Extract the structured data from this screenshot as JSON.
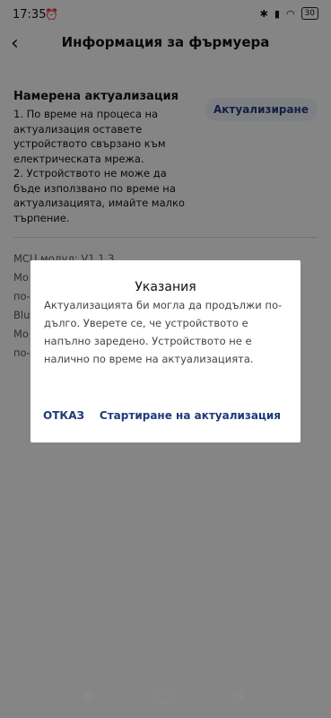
{
  "status_bar": {
    "time": "17:35",
    "alarm_icon": "⏰",
    "battery": "30"
  },
  "app_bar": {
    "title": "Информация за фърмуера",
    "back_icon": "‹"
  },
  "update": {
    "title": "Намерена актуализация",
    "body": "1. По време на процеса на актуализация оставете устройството свързано към електрическата мрежа.\n2. Устройството не може да бъде използвано по време на актуализацията, имайте малко търпение.",
    "button": "Актуализиране"
  },
  "info": [
    "MCU модул: V1.1.3",
    "Мо",
    "по-",
    "Blu",
    "Мо",
    "по-"
  ],
  "dialog": {
    "title": "Указания",
    "body": "Актуализацията би могла да продължи по-дълго. Уверете се, че устройството е напълно заредено. Устройството не е налично по време на актуализацията.",
    "cancel": "ОТКАЗ",
    "confirm": "Стартиране на актуализация"
  }
}
